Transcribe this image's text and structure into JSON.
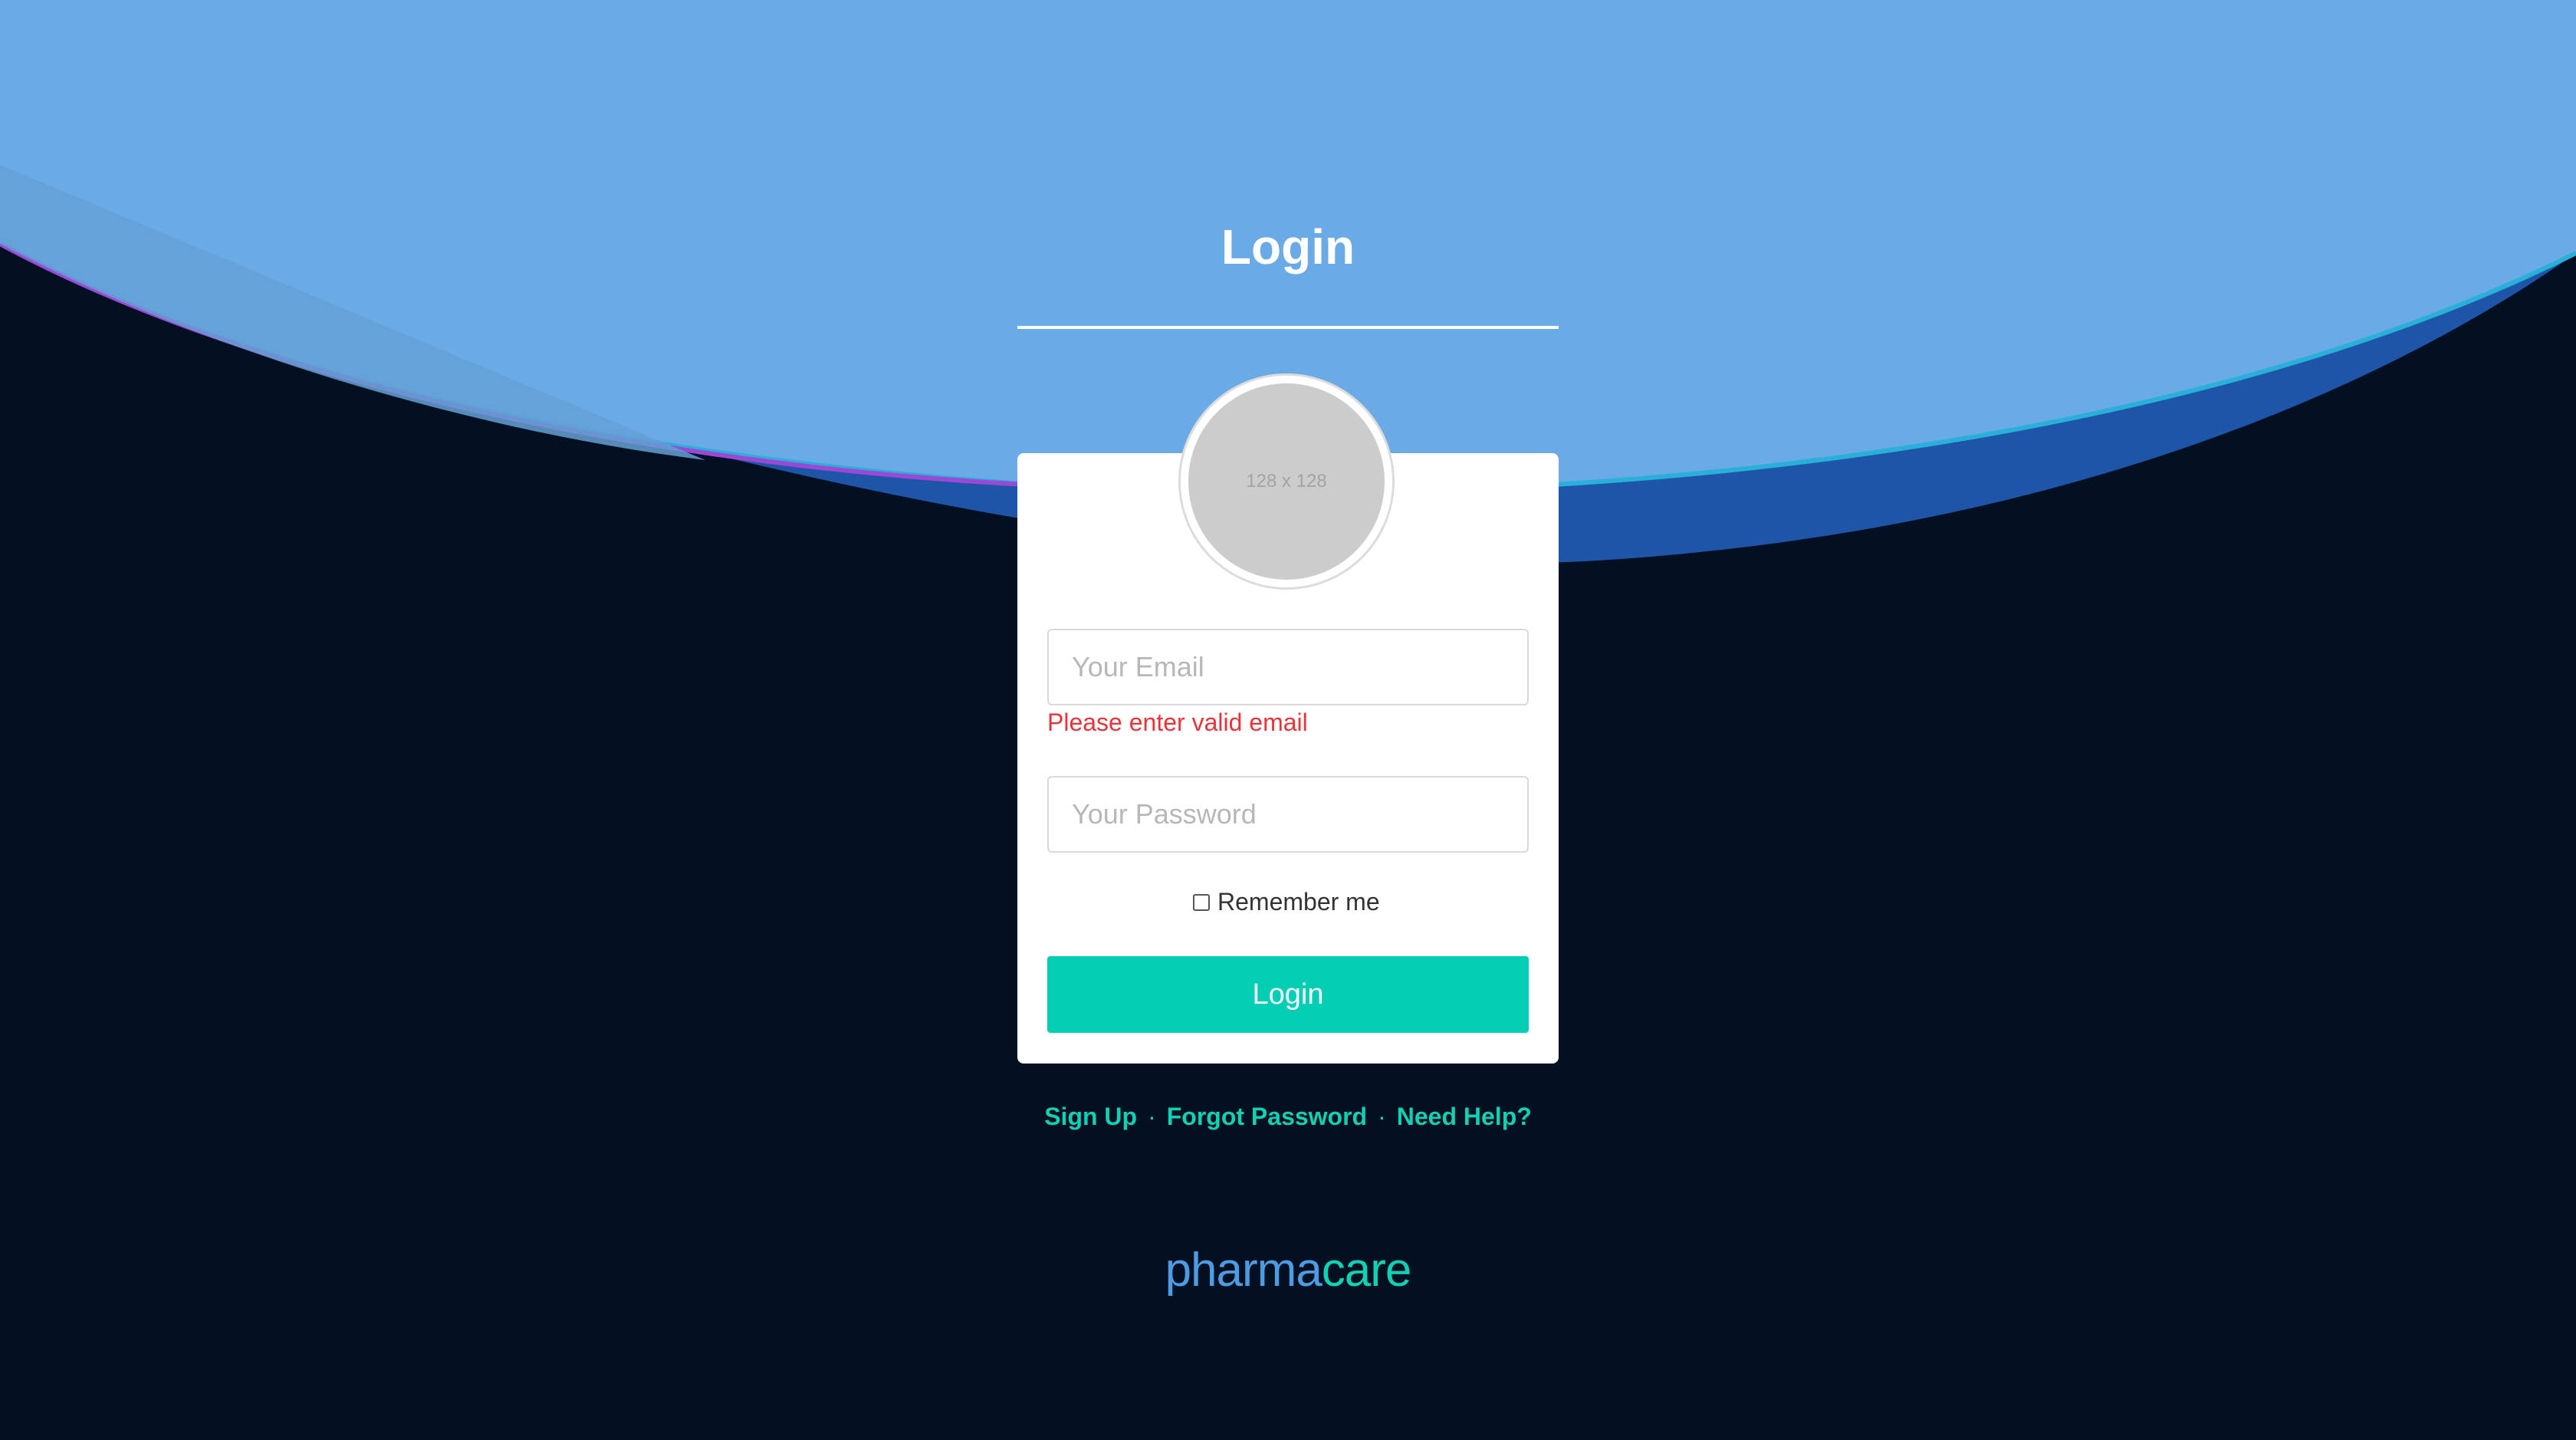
{
  "colors": {
    "background": "#021022",
    "header_wave": "#6aabe7",
    "accent": "#04cfb4",
    "error": "#e8333a",
    "link": "#0fd1b3",
    "brand_primary": "#4d9be2",
    "brand_secondary": "#0fd1b3"
  },
  "page": {
    "title": "Login"
  },
  "avatar": {
    "placeholder_text": "128 x 128"
  },
  "form": {
    "email_placeholder": "Your Email",
    "email_value": "",
    "email_error": "Please enter valid email",
    "password_placeholder": "Your Password",
    "password_value": "",
    "remember_label": "Remember me",
    "remember_checked": false,
    "submit_label": "Login"
  },
  "links": {
    "signup": "Sign Up",
    "forgot": "Forgot Password",
    "help": "Need Help?",
    "separator": "·"
  },
  "brand": {
    "part1": "pharma",
    "part2": "care"
  }
}
